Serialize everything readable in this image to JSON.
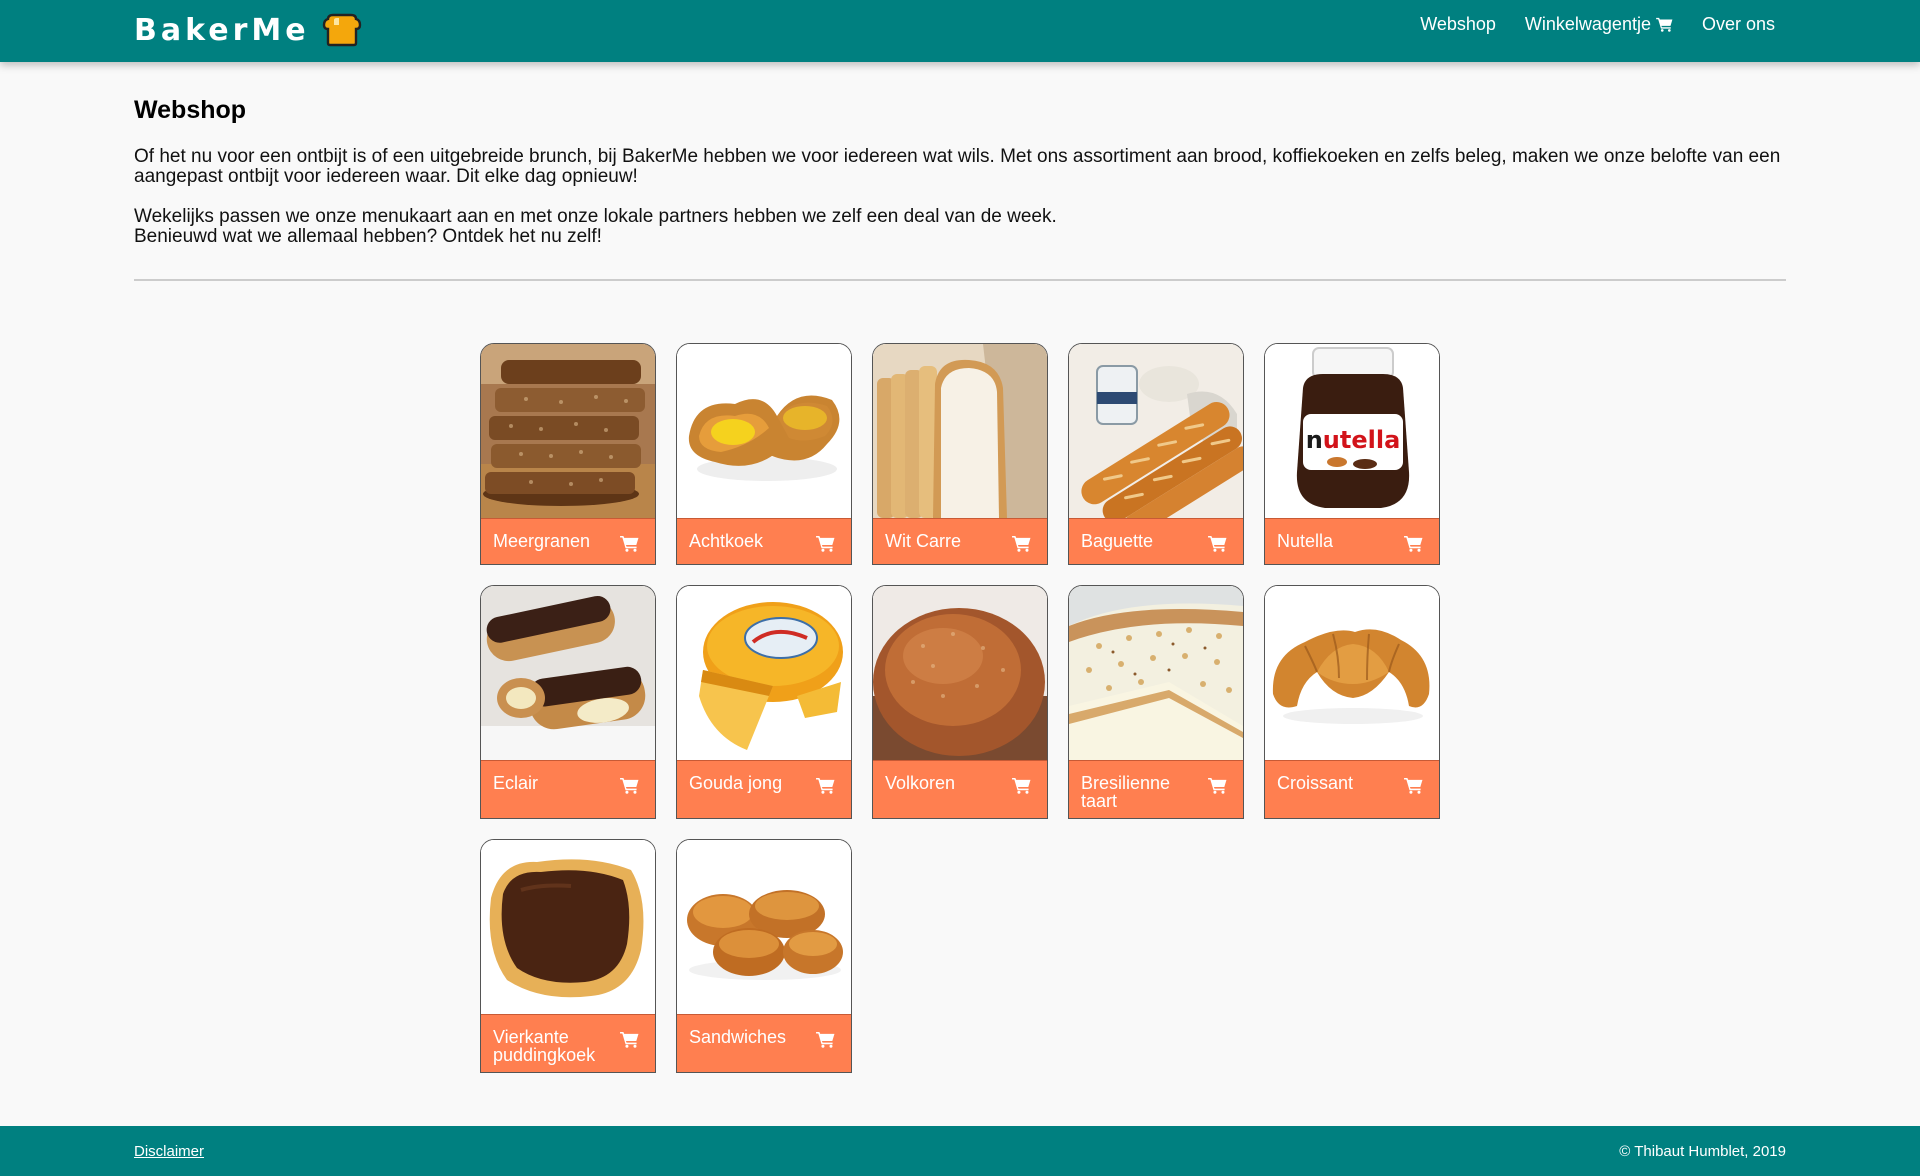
{
  "brand": {
    "name": "BakerMe",
    "icon": "toast-icon"
  },
  "nav": {
    "webshop": "Webshop",
    "cart": "Winkelwagentje",
    "about": "Over ons"
  },
  "page": {
    "title": "Webshop",
    "intro_1": "Of het nu voor een ontbijt is of een uitgebreide brunch, bij BakerMe hebben we voor iedereen wat wils. Met ons assortiment aan brood, koffiekoeken en zelfs beleg, maken we onze belofte van een aangepast ontbijt voor iedereen waar. Dit elke dag opnieuw!",
    "intro_2a": "Wekelijks passen we onze menukaart aan en met onze lokale partners hebben we zelf een deal van de week.",
    "intro_2b": "Benieuwd wat we allemaal hebben? Ontdek het nu zelf!"
  },
  "products": [
    {
      "name": "Meergranen",
      "image": "multigrain-bread-image"
    },
    {
      "name": "Achtkoek",
      "image": "custard-pastry-image"
    },
    {
      "name": "Wit Carre",
      "image": "white-bread-image"
    },
    {
      "name": "Baguette",
      "image": "baguette-image"
    },
    {
      "name": "Nutella",
      "image": "nutella-jar-image"
    },
    {
      "name": "Eclair",
      "image": "eclair-image"
    },
    {
      "name": "Gouda jong",
      "image": "gouda-cheese-image"
    },
    {
      "name": "Volkoren",
      "image": "wholewheat-bread-image"
    },
    {
      "name": "Bresilienne taart",
      "image": "bresilienne-tart-image"
    },
    {
      "name": "Croissant",
      "image": "croissant-image"
    },
    {
      "name": "Vierkante puddingkoek",
      "image": "square-pudding-pastry-image"
    },
    {
      "name": "Sandwiches",
      "image": "sandwich-rolls-image"
    }
  ],
  "footer": {
    "disclaimer": "Disclaimer",
    "copyright": "© Thibaut Humblet, 2019"
  },
  "colors": {
    "nav_bg": "#008080",
    "card_footer": "#ff7f50",
    "page_bg": "#f9f9f9"
  }
}
